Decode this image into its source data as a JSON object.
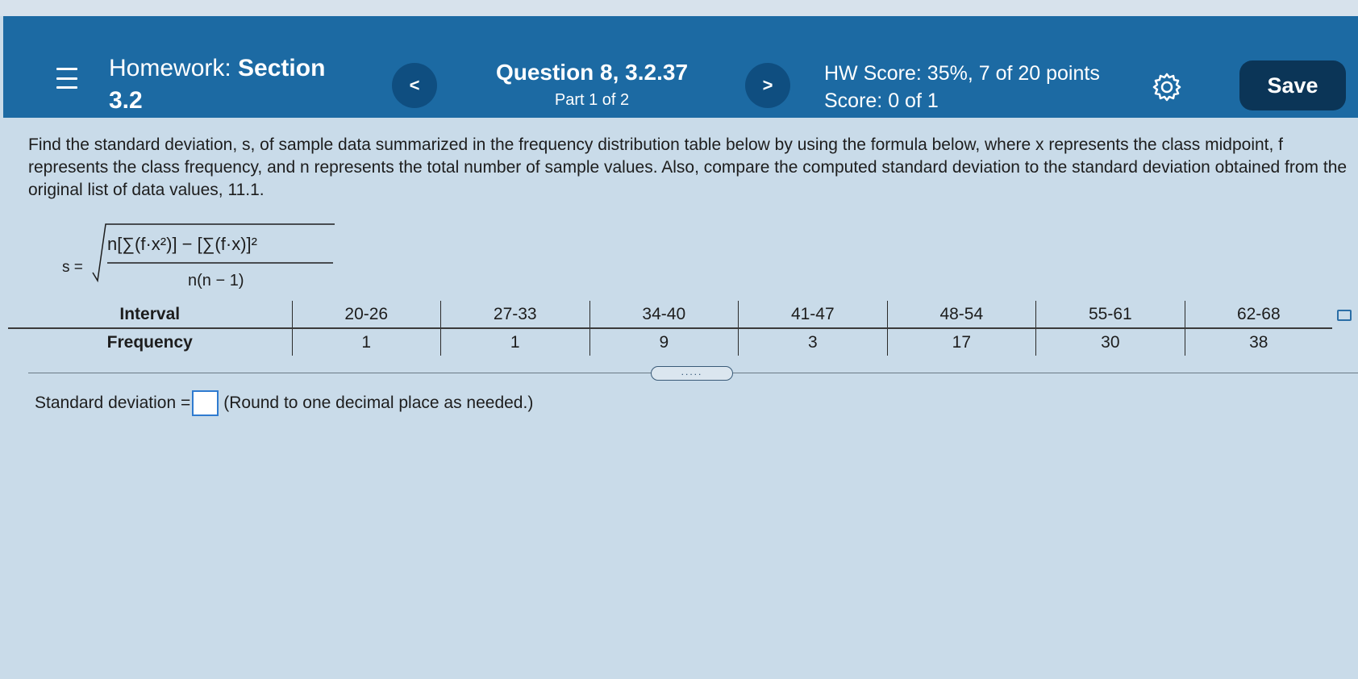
{
  "header": {
    "hw_prefix": "Homework:",
    "hw_section": "Section",
    "hw_number": "3.2",
    "prev_label": "<",
    "next_label": ">",
    "question_title": "Question 8, 3.2.37",
    "question_part": "Part 1 of 2",
    "hw_score": "HW Score: 35%, 7 of 20 points",
    "score": "Score: 0 of 1",
    "save_label": "Save"
  },
  "question": {
    "text": "Find the standard deviation, s, of sample data summarized in the frequency distribution table below by using the formula below, where x represents the class midpoint, f represents the class frequency, and n represents the total number of sample values. Also, compare the computed standard deviation to the standard deviation obtained from the original list of data values, 11.1.",
    "formula": {
      "lhs": "s =",
      "numerator": "n[∑(f·x²)] − [∑(f·x)]²",
      "denominator": "n(n − 1)"
    }
  },
  "table": {
    "interval_label": "Interval",
    "frequency_label": "Frequency",
    "intervals": [
      "20-26",
      "27-33",
      "34-40",
      "41-47",
      "48-54",
      "55-61",
      "62-68"
    ],
    "frequencies": [
      "1",
      "1",
      "9",
      "3",
      "17",
      "30",
      "38"
    ]
  },
  "divider_handle": ".....",
  "answer": {
    "label": "Standard deviation =",
    "hint": "(Round to one decimal place as needed.)"
  },
  "icons": {
    "menu": "hamburger-menu-icon",
    "settings": "gear-icon",
    "table": "copy-table-icon"
  },
  "colors": {
    "header_bg": "#1c6aa3",
    "save_bg": "#0b3557",
    "nav_btn_bg": "#0f4e80",
    "page_bg": "#c9dbe9"
  }
}
